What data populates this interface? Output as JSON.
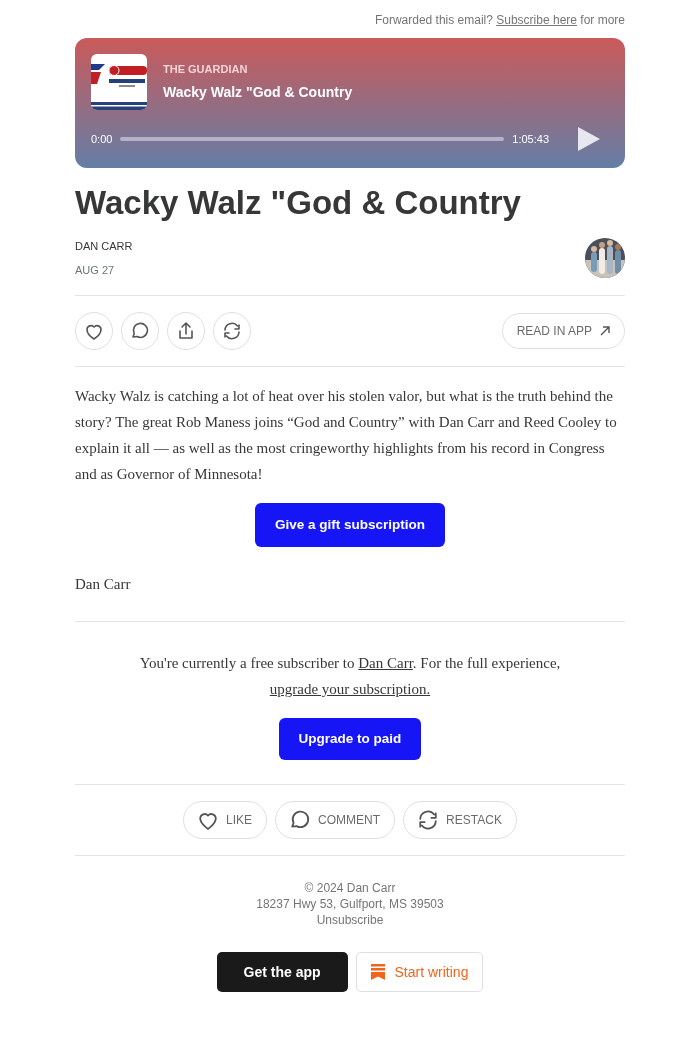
{
  "forward_note": {
    "before": "Forwarded this email?",
    "link": "Subscribe here",
    "after": "for more"
  },
  "player": {
    "publisher": "THE GUARDIAN",
    "title": "Wacky Walz \"God & Country",
    "elapsed": "0:00",
    "duration": "1:05:43",
    "level": 0
  },
  "post": {
    "title": "Wacky Walz \"God & Country",
    "author": "DAN CARR",
    "date": "AUG 27"
  },
  "actions": [
    {
      "kind": "like"
    },
    {
      "kind": "comment"
    },
    {
      "kind": "share"
    },
    {
      "kind": "restack"
    }
  ],
  "read_in_app": "READ IN APP",
  "body": "Wacky Walz is catching a lot of heat over his stolen valor, but what is the truth behind the story? The great Rob Maness joins “God and Country” with Dan Carr and Reed Cooley to explain it all — as well as the most cringeworthy highlights from his record in Congress and as Governor of Minnesota!",
  "gift_button": "Give a gift subscription",
  "signature": "Dan Carr",
  "subscriber_note": {
    "before": "You're currently a free subscriber to",
    "link": "Dan Carr",
    "middle": ". For the full experience,",
    "upgrade_link": "upgrade your subscription."
  },
  "upgrade_button": "Upgrade to paid",
  "engagement": [
    {
      "kind": "like",
      "label": "LIKE"
    },
    {
      "kind": "comment",
      "label": "COMMENT"
    },
    {
      "kind": "restack",
      "label": "RESTACK"
    }
  ],
  "footer": {
    "copyright": "© 2024 Dan Carr",
    "address": "18237 Hwy 53, Gulfport, MS 39503",
    "unsubscribe": "Unsubscribe"
  },
  "app_buttons": {
    "get_app": "Get the app",
    "start_writing": "Start writing"
  }
}
